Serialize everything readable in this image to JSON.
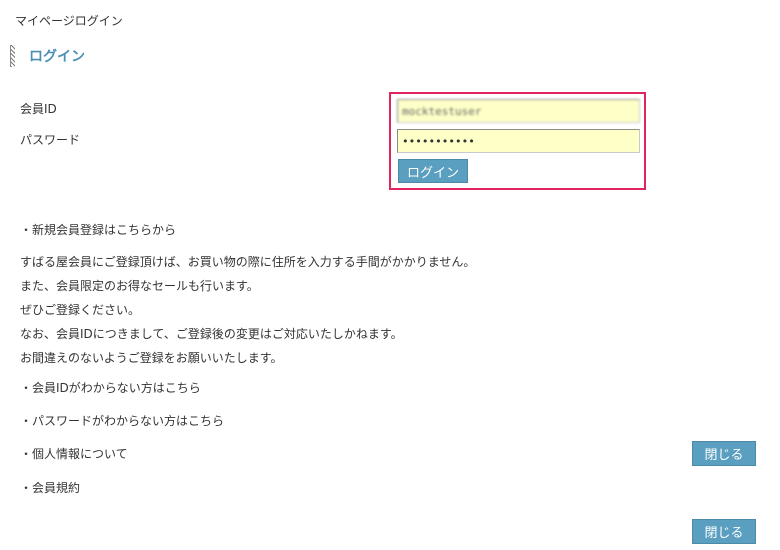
{
  "breadcrumb": "マイページログイン",
  "heading": "ログイン",
  "form": {
    "member_id_label": "会員ID",
    "password_label": "パスワード",
    "member_id_value": "mocktestuser",
    "password_value": "•••••••••••",
    "login_button": "ログイン"
  },
  "links": {
    "register": "・新規会員登録はこちらから",
    "forgot_id": "・会員IDがわからない方はこちら",
    "forgot_password": "・パスワードがわからない方はこちら",
    "privacy": "・個人情報について",
    "terms": "・会員規約"
  },
  "description": [
    "すばる屋会員にご登録頂けば、お買い物の際に住所を入力する手間がかかりません。",
    "また、会員限定のお得なセールも行います。",
    "ぜひご登録ください。",
    "なお、会員IDにつきまして、ご登録後の変更はご対応いたしかねます。",
    "お間違えのないようご登録をお願いいたします。"
  ],
  "close_button_1": "閉じる",
  "close_button_2": "閉じる",
  "colors": {
    "accent": "#5a9fc0",
    "heading": "#4b8fb5",
    "highlight_border": "#e0245e",
    "input_bg": "#ffffc8"
  }
}
